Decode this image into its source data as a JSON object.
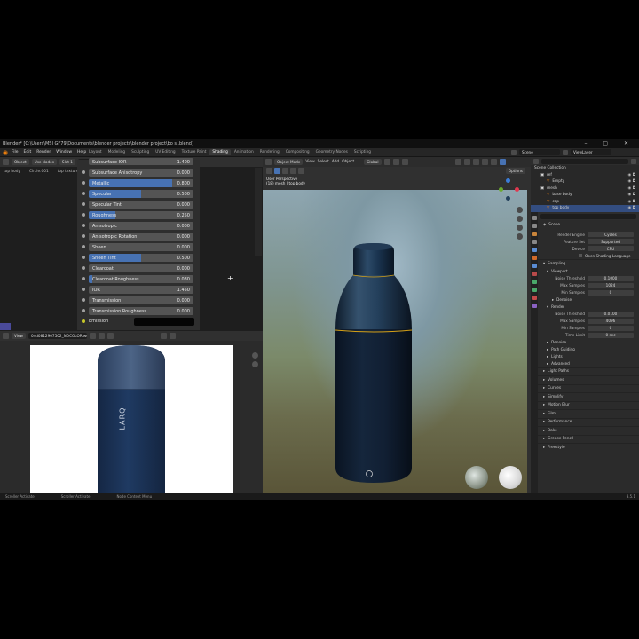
{
  "title_bar": "Blender* [C:\\Users\\MSI GF79\\Documents\\blender projects\\blender project\\bo sl.blend]",
  "menus": [
    "File",
    "Edit",
    "Render",
    "Window",
    "Help"
  ],
  "workspace_tabs": [
    "Layout",
    "Modeling",
    "Sculpting",
    "UV Editing",
    "Texture Paint",
    "Shading",
    "Animation",
    "Rendering",
    "Compositing",
    "Geometry Nodes",
    "Scripting"
  ],
  "active_workspace": "Shading",
  "scene": {
    "label": "Scene",
    "view_layer": "ViewLayer"
  },
  "node_editor": {
    "mode": "Object",
    "use_nodes": "Use Nodes",
    "slot": "Slot 1",
    "material": "top texture",
    "breadcrumb": [
      "top body",
      "Circle.001",
      "top texture"
    ],
    "truncated_top_row": "Subsurface IOR",
    "truncated_top_value": "1.400",
    "properties": [
      {
        "label": "Subsurface Anisotropy",
        "value": "0.000",
        "fill": 0
      },
      {
        "label": "Metallic",
        "value": "0.800",
        "fill": 0.8
      },
      {
        "label": "Specular",
        "value": "0.500",
        "fill": 0.5
      },
      {
        "label": "Specular Tint",
        "value": "0.000",
        "fill": 0
      },
      {
        "label": "Roughness",
        "value": "0.250",
        "fill": 0.25
      },
      {
        "label": "Anisotropic",
        "value": "0.000",
        "fill": 0
      },
      {
        "label": "Anisotropic Rotation",
        "value": "0.000",
        "fill": 0
      },
      {
        "label": "Sheen",
        "value": "0.000",
        "fill": 0
      },
      {
        "label": "Sheen Tint",
        "value": "0.500",
        "fill": 0.5
      },
      {
        "label": "Clearcoat",
        "value": "0.000",
        "fill": 0
      },
      {
        "label": "Clearcoat Roughness",
        "value": "0.030",
        "fill": 0.03
      },
      {
        "label": "IOR",
        "value": "1.450",
        "fill": 0
      },
      {
        "label": "Transmission",
        "value": "0.000",
        "fill": 0
      },
      {
        "label": "Transmission Roughness",
        "value": "0.000",
        "fill": 0
      }
    ],
    "emission_label": "Emission"
  },
  "image_editor": {
    "view": "View",
    "image_name": "04d0812907502_NOCOLOR.webp",
    "brand_text": "LARQ"
  },
  "viewport": {
    "mode": "Object Mode",
    "menus": [
      "View",
      "Select",
      "Add",
      "Object"
    ],
    "orientation": "Global",
    "options": "Options",
    "overlay_line1": "User Perspective",
    "overlay_line2": "(18) mesh | top body"
  },
  "outliner": {
    "header": "Scene Collection",
    "items": [
      {
        "name": "ref",
        "depth": 1
      },
      {
        "name": "Empty",
        "depth": 2
      },
      {
        "name": "mesh",
        "depth": 1
      },
      {
        "name": "base body",
        "depth": 2
      },
      {
        "name": "cap",
        "depth": 2
      },
      {
        "name": "top body",
        "depth": 2
      }
    ]
  },
  "properties": {
    "scene_label": "Scene",
    "render_engine_label": "Render Engine",
    "render_engine": "Cycles",
    "feature_set_label": "Feature Set",
    "feature_set": "Supported",
    "device_label": "Device",
    "device": "CPU",
    "osl": "Open Shading Language",
    "sampling": "Sampling",
    "viewport": "Viewport",
    "noise_threshold_label": "Noise Threshold",
    "vp_noise_threshold": "0.1000",
    "max_samples_label": "Max Samples",
    "vp_max_samples": "1024",
    "min_samples_label": "Min Samples",
    "vp_min_samples": "0",
    "denoise": "Denoise",
    "render": "Render",
    "r_noise_threshold": "0.0100",
    "r_max_samples": "4096",
    "r_min_samples": "0",
    "time_limit_label": "Time Limit",
    "time_limit": "0 sec",
    "denoise2": "Denoise",
    "path_guiding": "Path Guiding",
    "lights": "Lights",
    "advanced": "Advanced",
    "sections": [
      "Light Paths",
      "Volumes",
      "Curves",
      "Simplify",
      "Motion Blur",
      "Film",
      "Performance",
      "Bake",
      "Grease Pencil",
      "Freestyle"
    ]
  },
  "status_bar": [
    "Scroller Activate",
    "Scroller Activate",
    "Node Context Menu"
  ],
  "version": "3.5.1",
  "colors": {
    "accent": "#4772b3",
    "orange": "#e87d0d",
    "selected_row": "#334d80"
  }
}
